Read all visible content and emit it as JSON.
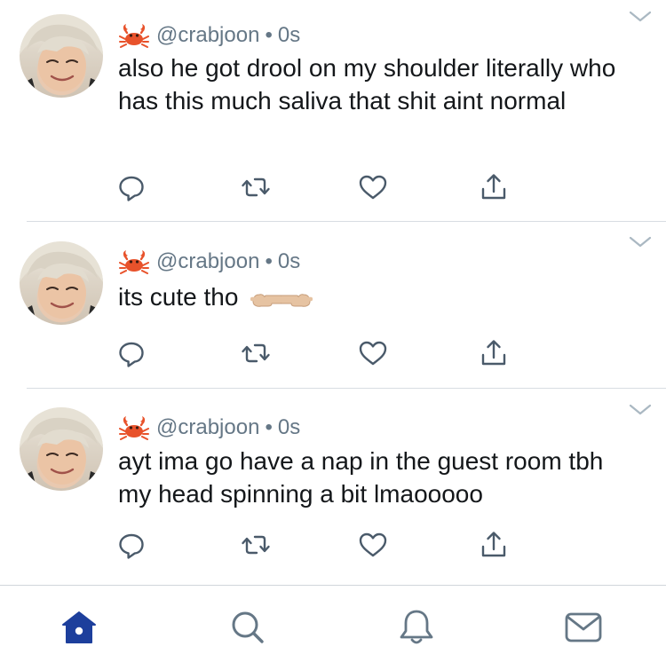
{
  "tweets": [
    {
      "handle": "@crabjoon",
      "separator": "•",
      "time": "0s",
      "text": "also he got drool on my shoulder literally who has this much saliva that shit aint normal"
    },
    {
      "handle": "@crabjoon",
      "separator": "•",
      "time": "0s",
      "text": "its cute tho"
    },
    {
      "handle": "@crabjoon",
      "separator": "•",
      "time": "0s",
      "text": "ayt ima go have a nap in the guest room tbh my head spinning a bit lmaooooo"
    }
  ],
  "icons": {
    "user_emoji": "crab-emoji-icon",
    "reply": "reply-icon",
    "retweet": "retweet-icon",
    "like": "heart-icon",
    "share": "share-icon",
    "menu": "chevron-down-icon",
    "home": "home-icon",
    "search": "search-icon",
    "notifications": "bell-icon",
    "messages": "mail-icon"
  },
  "colors": {
    "accent": "#1d3f9c",
    "text": "#14171a",
    "muted": "#657786",
    "icon_gray": "#657786"
  }
}
